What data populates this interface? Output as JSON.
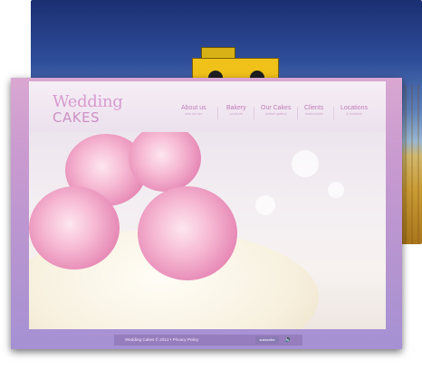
{
  "background_slide": {
    "description": "harvester on golden field under blue sky"
  },
  "logo": {
    "line1": "Wedding",
    "line2": "CAKES"
  },
  "nav": [
    {
      "label": "About us",
      "sub": "who we are"
    },
    {
      "label": "Bakery",
      "sub": "products"
    },
    {
      "label": "Our Cakes",
      "sub": "picture gallery"
    },
    {
      "label": "Clients",
      "sub": "testimonials"
    },
    {
      "label": "Locations",
      "sub": "& contacts"
    }
  ],
  "footer": {
    "copyright": "Wedding Cakes © 2012 • Privacy Policy",
    "subscribe_label": "subscribe",
    "sound_icon": "speaker-icon"
  },
  "colors": {
    "accent": "#c17db7",
    "frame": "#c99ad0"
  }
}
